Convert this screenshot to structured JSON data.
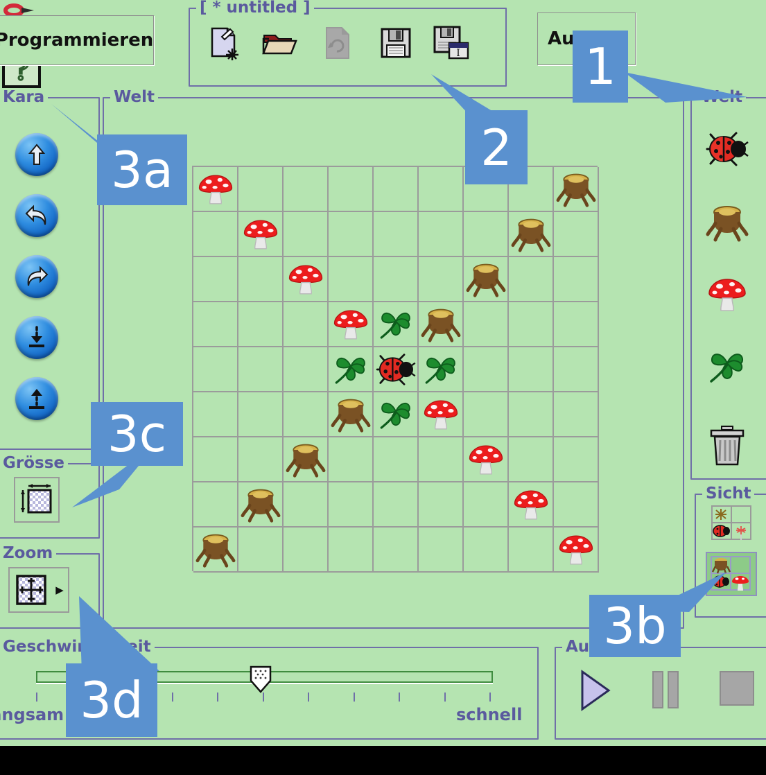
{
  "app": {
    "background_color": "#b5e4b1",
    "panel_border_color": "#6f6fa8",
    "panel_title_color": "#5a5a9e",
    "callout_color": "#5a91cf",
    "grid_line_color": "#9b9b9b"
  },
  "top": {
    "program_tab_label": "Programmieren",
    "file_group_title": "[ * untitled ]",
    "file_buttons": [
      {
        "name": "new-file-icon",
        "label": "Neu",
        "enabled": true
      },
      {
        "name": "open-file-icon",
        "label": "Öffnen",
        "enabled": true
      },
      {
        "name": "reload-file-icon",
        "label": "Neu laden",
        "enabled": false
      },
      {
        "name": "save-file-icon",
        "label": "Speichern",
        "enabled": true
      },
      {
        "name": "save-as-file-icon",
        "label": "Speichern unter",
        "enabled": true
      }
    ],
    "second_tab_label": "Au",
    "tools_icon": "tools-icon",
    "help_icon": "help-question-icon"
  },
  "kara_panel": {
    "title": "Kara",
    "buttons": [
      {
        "name": "kara-move-forward-button",
        "icon": "arrow-up-icon"
      },
      {
        "name": "kara-turn-left-button",
        "icon": "arrow-turn-left-icon"
      },
      {
        "name": "kara-turn-right-button",
        "icon": "arrow-turn-right-icon"
      },
      {
        "name": "kara-put-leaf-button",
        "icon": "arrow-down-to-bar-icon"
      },
      {
        "name": "kara-remove-leaf-button",
        "icon": "arrow-up-from-bar-icon"
      }
    ]
  },
  "groesse_panel": {
    "title": "Grösse",
    "button_name": "world-size-button",
    "icon": "resize-grid-icon"
  },
  "zoom_panel": {
    "title": "Zoom",
    "button_name": "zoom-button",
    "icon": "zoom-grid-icon",
    "dropdown_icon": "chevron-right-icon"
  },
  "speed_panel": {
    "title": "Geschwindigkeit",
    "slow_label": "langsam",
    "fast_label": "schnell",
    "value_percent": 50,
    "tick_count": 11
  },
  "world_panel": {
    "title": "Welt"
  },
  "palette_panel": {
    "title": "Welt",
    "items": [
      {
        "name": "palette-kara-ladybug",
        "icon": "ladybug-icon"
      },
      {
        "name": "palette-tree-stump",
        "icon": "tree-stump-icon"
      },
      {
        "name": "palette-mushroom",
        "icon": "mushroom-icon"
      },
      {
        "name": "palette-clover-leaf",
        "icon": "clover-leaf-icon"
      },
      {
        "name": "palette-trash",
        "icon": "trash-can-icon"
      }
    ]
  },
  "sicht_panel": {
    "title": "Sicht",
    "options": [
      {
        "name": "sicht-option-outline",
        "icon": "sensor-view-outline-icon",
        "selected": false
      },
      {
        "name": "sicht-option-solid",
        "icon": "sensor-view-solid-icon",
        "selected": true
      }
    ]
  },
  "playback_panel": {
    "title": "Au",
    "buttons": [
      {
        "name": "play-button",
        "icon": "play-icon",
        "enabled": true
      },
      {
        "name": "pause-button",
        "icon": "pause-icon",
        "enabled": false
      },
      {
        "name": "stop-button",
        "icon": "stop-icon",
        "enabled": false
      }
    ]
  },
  "callouts": [
    {
      "name": "callout-1",
      "label": "1"
    },
    {
      "name": "callout-2",
      "label": "2"
    },
    {
      "name": "callout-3a",
      "label": "3a"
    },
    {
      "name": "callout-3b",
      "label": "3b"
    },
    {
      "name": "callout-3c",
      "label": "3c"
    },
    {
      "name": "callout-3d",
      "label": "3d"
    }
  ],
  "world": {
    "columns": 9,
    "rows": 9,
    "cells": [
      [
        "mushroom",
        "",
        "",
        "",
        "",
        "",
        "",
        "",
        "stump"
      ],
      [
        "",
        "mushroom",
        "",
        "",
        "",
        "",
        "",
        "stump",
        ""
      ],
      [
        "",
        "",
        "mushroom",
        "",
        "",
        "",
        "stump",
        "",
        ""
      ],
      [
        "",
        "",
        "",
        "mushroom",
        "clover",
        "stump",
        "",
        "",
        ""
      ],
      [
        "",
        "",
        "",
        "clover",
        "kara",
        "clover",
        "",
        "",
        ""
      ],
      [
        "",
        "",
        "",
        "stump",
        "clover",
        "mushroom",
        "",
        "",
        ""
      ],
      [
        "",
        "",
        "stump",
        "",
        "",
        "",
        "mushroom",
        "",
        ""
      ],
      [
        "",
        "stump",
        "",
        "",
        "",
        "",
        "",
        "mushroom",
        ""
      ],
      [
        "stump",
        "",
        "",
        "",
        "",
        "",
        "",
        "",
        "mushroom"
      ]
    ]
  }
}
